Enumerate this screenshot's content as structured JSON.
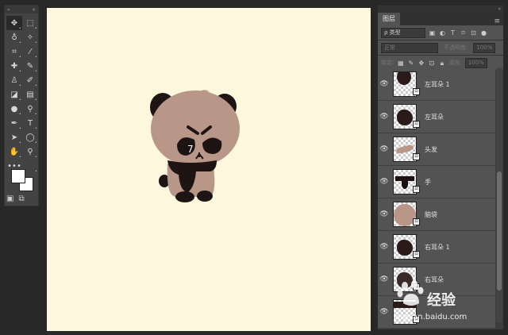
{
  "toolbar": {
    "collapse_label": "«",
    "close_label": "×",
    "tools": [
      {
        "icon": "move-icon",
        "glyph": "✥",
        "selected": true
      },
      {
        "icon": "marquee-icon",
        "glyph": "⬚"
      },
      {
        "icon": "lasso-icon",
        "glyph": "♁"
      },
      {
        "icon": "magic-wand-icon",
        "glyph": "✧"
      },
      {
        "icon": "crop-icon",
        "glyph": "⌗"
      },
      {
        "icon": "eyedropper-icon",
        "glyph": "⁄"
      },
      {
        "icon": "healing-brush-icon",
        "glyph": "✚"
      },
      {
        "icon": "brush-icon",
        "glyph": "✎"
      },
      {
        "icon": "clone-stamp-icon",
        "glyph": "♙"
      },
      {
        "icon": "history-brush-icon",
        "glyph": "✐"
      },
      {
        "icon": "eraser-icon",
        "glyph": "◪"
      },
      {
        "icon": "gradient-icon",
        "glyph": "▤"
      },
      {
        "icon": "blur-icon",
        "glyph": "●"
      },
      {
        "icon": "dodge-icon",
        "glyph": "⚲"
      },
      {
        "icon": "pen-icon",
        "glyph": "✒"
      },
      {
        "icon": "type-icon",
        "glyph": "T"
      },
      {
        "icon": "path-selection-icon",
        "glyph": "➤"
      },
      {
        "icon": "ellipse-icon",
        "glyph": "◯"
      },
      {
        "icon": "hand-icon",
        "glyph": "✋"
      },
      {
        "icon": "zoom-icon",
        "glyph": "⚲"
      },
      {
        "icon": "more-tools-icon",
        "glyph": "•••"
      },
      {
        "icon": "blank-icon",
        "glyph": ""
      }
    ],
    "bottom_icons": [
      {
        "icon": "quick-mask-icon",
        "glyph": "▣"
      },
      {
        "icon": "screen-mode-icon",
        "glyph": "⧉"
      }
    ],
    "colors": {
      "foreground": "#ffffff",
      "background": "#ffffff"
    }
  },
  "canvas": {
    "background": "#fdf7dd"
  },
  "layers_panel": {
    "collapse_label": "»",
    "tab_label": "图层",
    "menu_glyph": "≡",
    "filter_label": "ρ 类型",
    "blend_mode": "正常",
    "opacity_label": "不透明度:",
    "opacity_value": "100%",
    "lock_label": "锁定:",
    "fill_label": "填充:",
    "fill_value": "100%",
    "layers": [
      {
        "name": "左耳朵 1",
        "thumb": "dark-partial",
        "color": "#2b1a1a"
      },
      {
        "name": "左耳朵",
        "thumb": "dark-blob",
        "color": "#2b1a1a"
      },
      {
        "name": "头发",
        "thumb": "hair",
        "color": "#b89688"
      },
      {
        "name": "手",
        "thumb": "hands",
        "color": "#1c1010"
      },
      {
        "name": "脑袋",
        "thumb": "head",
        "color": "#b89688"
      },
      {
        "name": "右耳朵 1",
        "thumb": "dark-blob",
        "color": "#2b1a1a"
      },
      {
        "name": "右耳朵",
        "thumb": "dark-blob",
        "color": "#3a2a2a"
      },
      {
        "name": "",
        "thumb": "dark-strip",
        "color": "#2b1a1a"
      }
    ]
  },
  "watermark": {
    "brand": "经验",
    "url": "jingyan.baidu.com"
  },
  "colors": {
    "body": "#b89688",
    "dark": "#1f1414",
    "ui_dark": "#282828"
  }
}
